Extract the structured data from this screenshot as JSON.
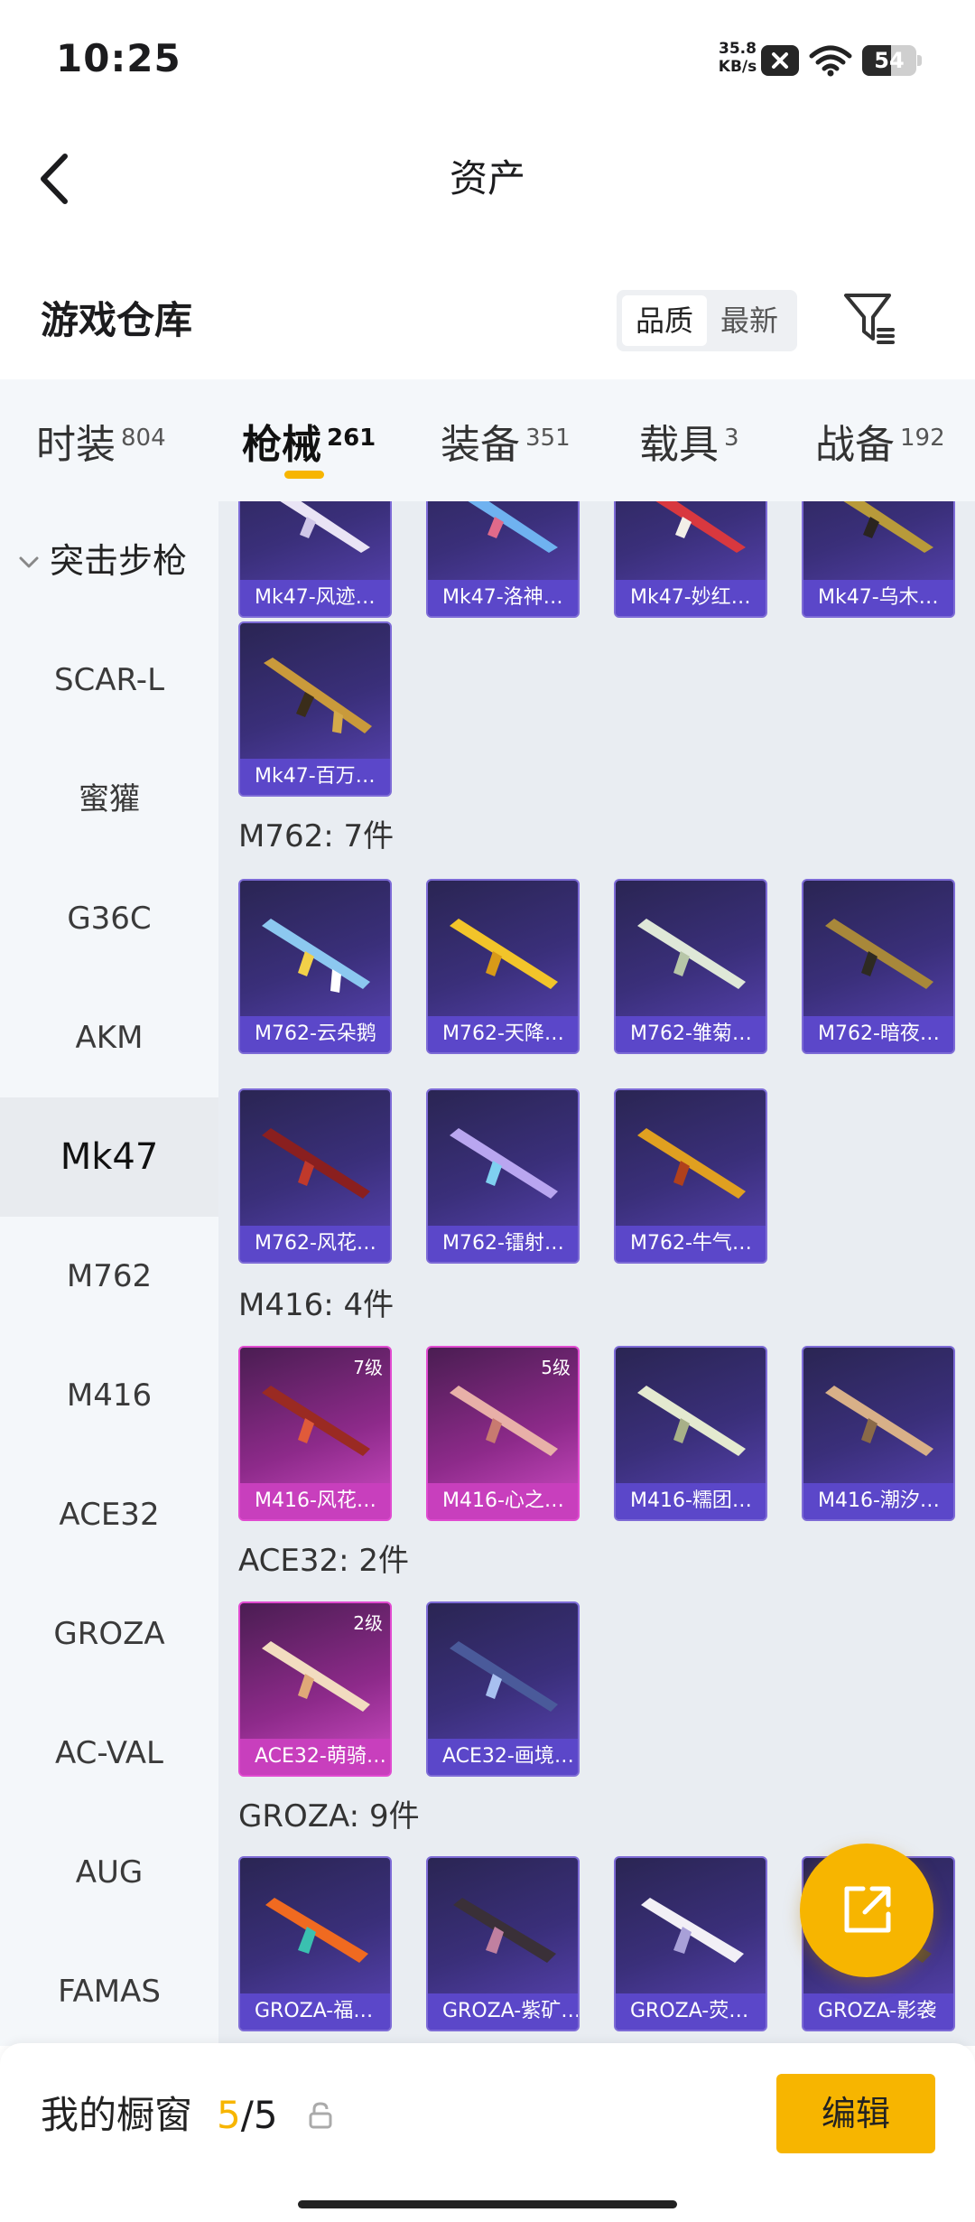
{
  "status_bar": {
    "time": "10:25",
    "net_speed_value": "35.8",
    "net_speed_unit": "KB/s",
    "battery": "54",
    "battery_level": 0.54
  },
  "nav": {
    "title": "资产"
  },
  "warehouse": {
    "title": "游戏仓库",
    "sort_options": [
      "品质",
      "最新"
    ],
    "sort_selected": "品质"
  },
  "tabs": [
    {
      "label": "时装",
      "count": "804"
    },
    {
      "label": "枪械",
      "count": "261",
      "active": true
    },
    {
      "label": "装备",
      "count": "351"
    },
    {
      "label": "载具",
      "count": "3"
    },
    {
      "label": "战备",
      "count": "192"
    }
  ],
  "side_nav": {
    "group_label": "突击步枪",
    "items": [
      "SCAR-L",
      "蜜獾",
      "G36C",
      "AKM",
      "Mk47",
      "M762",
      "M416",
      "ACE32",
      "GROZA",
      "AC-VAL",
      "AUG",
      "FAMAS"
    ],
    "active": "Mk47"
  },
  "sections": [
    {
      "heading": "",
      "items": [
        {
          "label": "Mk47-风迹…"
        },
        {
          "label": "Mk47-洛神…"
        },
        {
          "label": "Mk47-妙红…"
        },
        {
          "label": "Mk47-乌木…"
        },
        {
          "label": "Mk47-百万…"
        }
      ]
    },
    {
      "heading": "M762: 7件",
      "items": [
        {
          "label": "M762-云朵鹅"
        },
        {
          "label": "M762-天降…"
        },
        {
          "label": "M762-雏菊…"
        },
        {
          "label": "M762-暗夜…"
        },
        {
          "label": "M762-风花…"
        },
        {
          "label": "M762-镭射…"
        },
        {
          "label": "M762-牛气…"
        }
      ]
    },
    {
      "heading": "M416: 4件",
      "items": [
        {
          "label": "M416-风花…",
          "level": "7级"
        },
        {
          "label": "M416-心之…",
          "level": "5级"
        },
        {
          "label": "M416-糯团…"
        },
        {
          "label": "M416-潮汐…"
        }
      ]
    },
    {
      "heading": "ACE32: 2件",
      "items": [
        {
          "label": "ACE32-萌骑…",
          "level": "2级"
        },
        {
          "label": "ACE32-画境…"
        }
      ]
    },
    {
      "heading": "GROZA: 9件",
      "items": [
        {
          "label": "GROZA-福…"
        },
        {
          "label": "GROZA-紫矿…"
        },
        {
          "label": "GROZA-荧…"
        },
        {
          "label": "GROZA-影袭"
        }
      ]
    }
  ],
  "bottom_bar": {
    "showcase_label": "我的橱窗",
    "showcase_current": "5",
    "showcase_sep": "/",
    "showcase_total": "5",
    "edit_label": "编辑"
  },
  "colors": {
    "accent": "#f7b500",
    "card_purple": "#5b47c9",
    "card_pink": "#c83fbd"
  },
  "icons": [
    "back-chevron-icon",
    "filter-icon",
    "chevron-down-icon",
    "share-icon",
    "lock-icon",
    "wifi-icon",
    "battery-icon"
  ]
}
